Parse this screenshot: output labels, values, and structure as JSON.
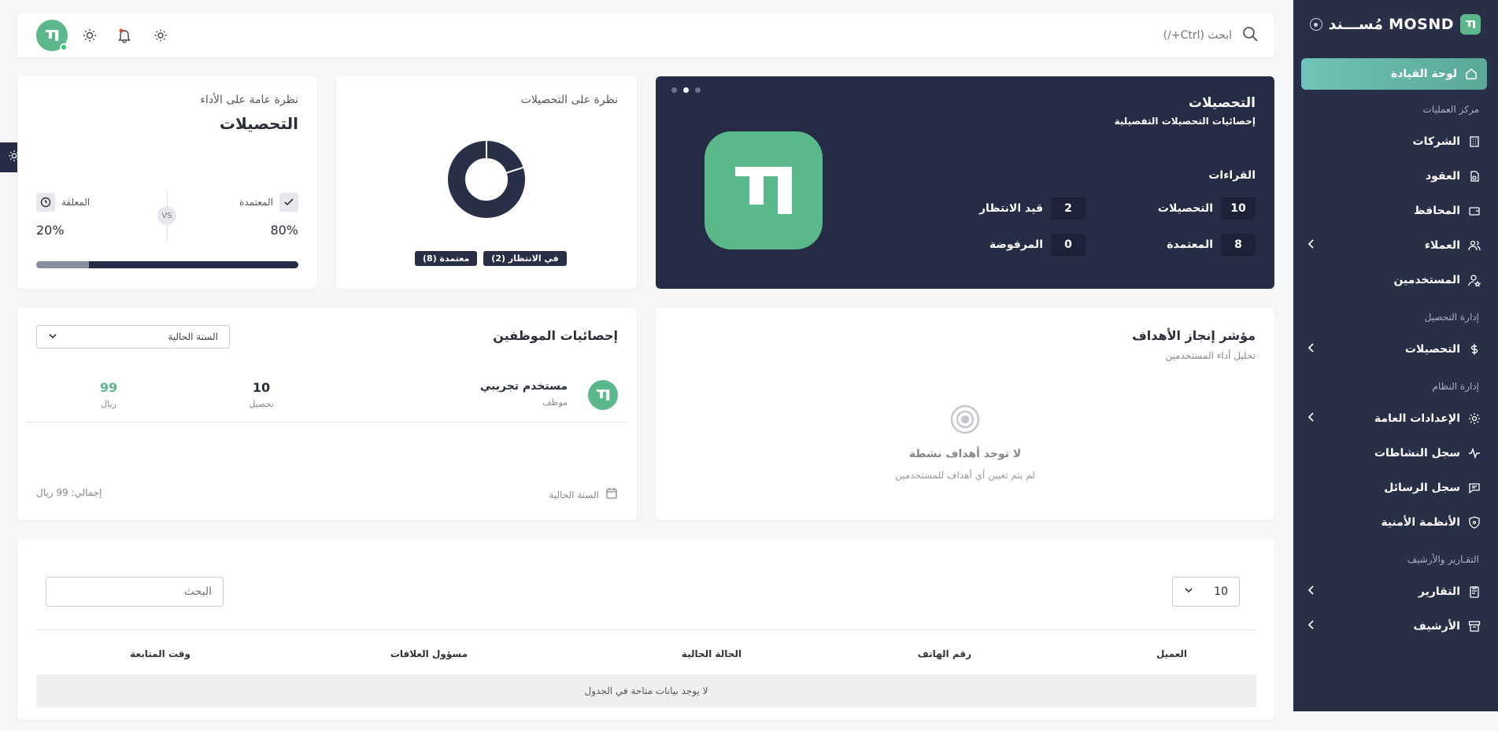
{
  "sidebar": {
    "brand": "MOSND مُســـند",
    "active_item": "لوحة القيادة",
    "sections": {
      "operations": "مركز العمليات",
      "collection": "إدارة التحصيل",
      "system": "إدارة النظام",
      "reports": "التقـارير والأرشيف"
    },
    "items": {
      "companies": "الشركات",
      "contracts": "العقود",
      "portfolios": "المحافظ",
      "clients": "العملاء",
      "users": "المستخدمين",
      "collections": "التحصيلات",
      "general_settings": "الإعدادات العامة",
      "activity_log": "سجل النشاطات",
      "messages_log": "سجل الرسائل",
      "security": "الأنظمة الأمنية",
      "reports": "التقارير",
      "archive": "الأرشيف"
    }
  },
  "topbar": {
    "search_placeholder": "ابحث (Ctrl+/)"
  },
  "hero": {
    "title": "التحصيلات",
    "subtitle": "إحصائيات التحصيلات التفصيلية",
    "readings_label": "القراءات",
    "stats": [
      {
        "value": "10",
        "label": "التحصيلات"
      },
      {
        "value": "2",
        "label": "قيد الانتظار"
      },
      {
        "value": "8",
        "label": "المعتمدة"
      },
      {
        "value": "0",
        "label": "المرفوضة"
      }
    ]
  },
  "donut_card": {
    "title": "نظرة على التحصيلات",
    "badge_pending": "في الانتظار (2)",
    "badge_approved": "معتمدة (8)",
    "chart_data": {
      "type": "pie",
      "categories": [
        "معتمدة",
        "في الانتظار"
      ],
      "values": [
        8,
        2
      ]
    }
  },
  "performance_card": {
    "subtitle": "نظرة عامة على الأداء",
    "title": "التحصيلات",
    "approved_label": "المعتمدة",
    "pending_label": "المعلقة",
    "vs": "VS",
    "approved_pct": "80%",
    "pending_pct": "20%",
    "pending_fraction": 0.2
  },
  "goals_card": {
    "title": "مؤشر إنجاز الأهداف",
    "subtitle": "تحليل أداء المستخدمين",
    "empty_title": "لا توجد أهداف نشطة",
    "empty_text": "لم يتم تعيين أي أهداف للمستخدمين"
  },
  "employees_card": {
    "title": "إحصائيات الموظفين",
    "period_select": "السنة الحالية",
    "employee_name": "مستخدم تجريبي",
    "employee_role": "موظف",
    "collections_count": "10",
    "collections_label": "تحصيل",
    "amount": "99",
    "currency": "ريال",
    "footer_period": "السنة الحالية",
    "footer_total": "إجمالي: 99 ريال"
  },
  "table": {
    "page_size": "10",
    "search_placeholder": "البحث",
    "columns": [
      "العميل",
      "رقم الهاتف",
      "الحالة الحالية",
      "مسؤول العلاقات",
      "وقت المتابعة"
    ],
    "empty_message": "لا يوجد بيانات متاحة في الجدول"
  }
}
